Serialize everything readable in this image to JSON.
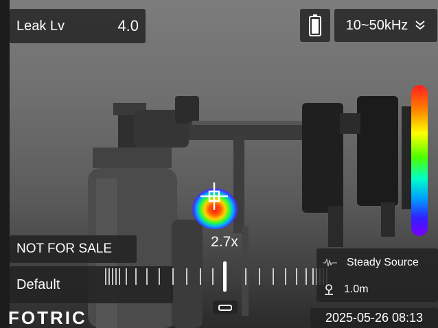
{
  "header": {
    "leak_label": "Leak Lv",
    "leak_value": "4.0",
    "battery_icon": "battery-icon",
    "frequency_range": "10~50kHz",
    "frequency_icon": "chevron-double-down-icon"
  },
  "overlay": {
    "zoom_level": "2.7x",
    "watermark": "NOT FOR SALE"
  },
  "color_scale": [
    "#ff1f1f",
    "#ff7f00",
    "#ffff00",
    "#4cff00",
    "#00ffc8",
    "#00a0ff",
    "#3020ff",
    "#7a00ff"
  ],
  "controls": {
    "preset_name": "Default"
  },
  "source": {
    "mode_icon": "waveform-icon",
    "mode_label": "Steady Source",
    "distance_icon": "location-pin-icon",
    "distance": "1.0m"
  },
  "footer": {
    "brand": "FOTRIC",
    "timestamp": "2025-05-26 08:13"
  }
}
